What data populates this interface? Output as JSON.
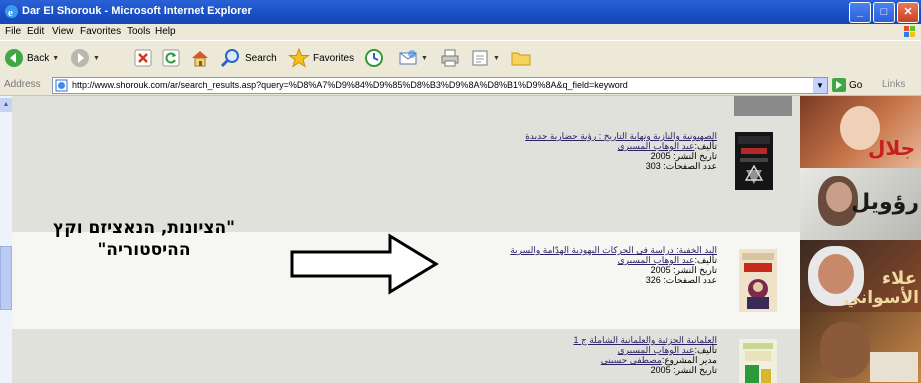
{
  "window": {
    "title": "Dar El Shorouk - Microsoft Internet Explorer",
    "buttons": [
      "minimize",
      "maximize",
      "close"
    ]
  },
  "menubar": {
    "items": [
      "File",
      "Edit",
      "View",
      "Favorites",
      "Tools",
      "Help"
    ]
  },
  "toolbar": {
    "back_label": "Back",
    "search_label": "Search",
    "favorites_label": "Favorites"
  },
  "addressbar": {
    "label": "Address",
    "url": "http://www.shorouk.com/ar/search_results.asp?query=%D8%A7%D9%84%D9%85%D8%B3%D9%8A%D8%B1%D9%8A&q_field=keyword",
    "go_label": "Go",
    "links_label": "Links"
  },
  "results": [
    {
      "title": "الصهيونية والنازية ونهاية التاريخ : رؤية حضارية جديدة",
      "author_prefix": "تأليف:",
      "author": "عبد الوهاب المسيري",
      "date_label": "تاريخ النشر: 2005",
      "pages_label": "عدد الصفحات: 303"
    },
    {
      "title": "اليد الخفية: دراسة في الحركات اليهودية الهدّامة والسرية",
      "author_prefix": "تأليف:",
      "author": "عبد الوهاب المسيري",
      "date_label": "تاريخ النشر: 2005",
      "pages_label": "عدد الصفحات: 326"
    },
    {
      "title": "العلمانية الجزئية والعلمانية الشاملة ج 1",
      "author_prefix": "تأليف:",
      "author": "عبد الوهاب المسيري",
      "editor_label": "مدير المشروع:",
      "editor": "مصطفى حسيني",
      "date_label": "تاريخ النشر: 2005"
    }
  ],
  "sidebar": {
    "banner_texts": [
      "جلال",
      "رؤويل",
      "علاء",
      "الأسواني"
    ]
  },
  "annotation": {
    "line1": "\"הציונות, הנאציזם וקץ",
    "line2": "ההיסטוריה\""
  }
}
